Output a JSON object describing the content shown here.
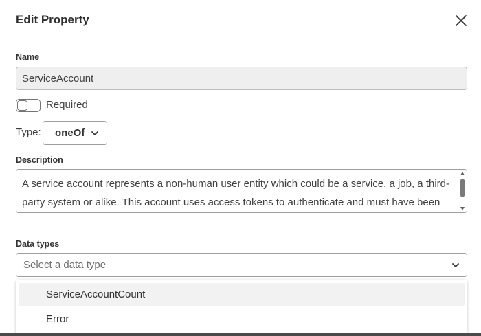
{
  "dialog": {
    "title": "Edit Property",
    "close_icon": "close-icon"
  },
  "name_field": {
    "label": "Name",
    "value": "ServiceAccount"
  },
  "required": {
    "label": "Required",
    "checked": false
  },
  "type_field": {
    "label": "Type:",
    "value": "oneOf",
    "icon": "chevron-down-icon"
  },
  "description": {
    "label": "Description",
    "value": "A service account represents a non-human user entity which could be a service, a job, a third-party system or alike. This account uses access tokens to authenticate and must have been"
  },
  "data_types": {
    "label": "Data types",
    "placeholder": "Select a data type",
    "icon": "chevron-down-icon",
    "options": [
      {
        "label": "ServiceAccountCount",
        "highlighted": true
      },
      {
        "label": "Error",
        "highlighted": false
      }
    ]
  }
}
